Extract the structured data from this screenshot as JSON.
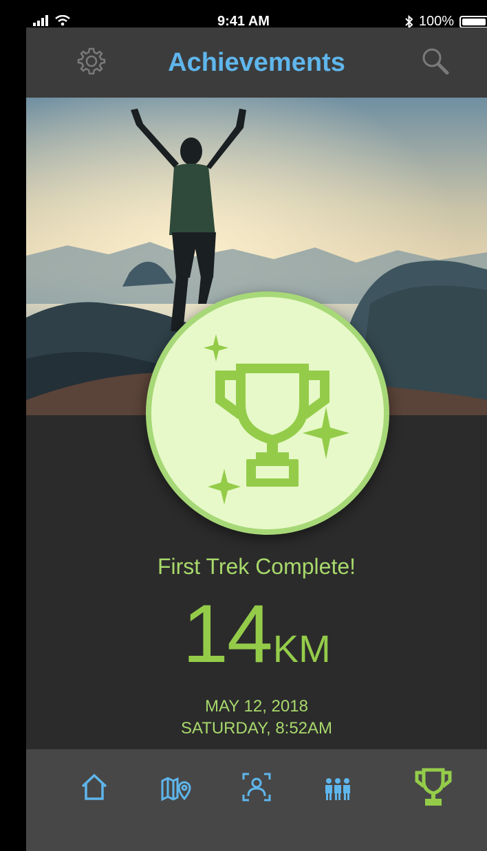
{
  "status_bar": {
    "time": "9:41 AM",
    "battery": "100%",
    "signal_icon": "signal-icon",
    "wifi_icon": "wifi-icon",
    "bluetooth_icon": "bluetooth-icon"
  },
  "header": {
    "title": "Achievements",
    "left_icon": "gear-icon",
    "right_icon": "search-icon"
  },
  "achievement": {
    "title": "First Trek Complete!",
    "distance": "14",
    "unit": "KM",
    "date": "MAY 12, 2018",
    "day_time": "SATURDAY, 8:52AM",
    "badge_icon": "trophy-icon"
  },
  "tabs": [
    {
      "icon": "home-icon",
      "active": false
    },
    {
      "icon": "map-icon",
      "active": false
    },
    {
      "icon": "profile-scan-icon",
      "active": false
    },
    {
      "icon": "group-icon",
      "active": false
    },
    {
      "icon": "trophy-icon",
      "active": true
    }
  ],
  "colors": {
    "accent_blue": "#5fb6ec",
    "accent_green": "#94cc4a",
    "badge_fill": "#e7f9c8",
    "background": "#2b2b2b"
  }
}
